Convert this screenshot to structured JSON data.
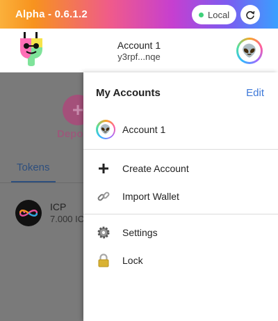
{
  "topbar": {
    "version": "Alpha - 0.6.1.2",
    "environment": "Local",
    "environment_status_color": "#3fd07a",
    "refresh_icon": "refresh-icon"
  },
  "header": {
    "account_name": "Account 1",
    "account_address": "y3rpf...nqe",
    "avatar_icon": "alien-icon"
  },
  "background": {
    "deposit_label": "Depo",
    "tab_tokens": "Tokens",
    "token": {
      "symbol": "ICP",
      "amount": "7.000 IC"
    }
  },
  "menu": {
    "title": "My Accounts",
    "edit_label": "Edit",
    "accounts": [
      {
        "label": "Account 1",
        "icon": "alien-icon"
      }
    ],
    "actions": [
      {
        "label": "Create Account",
        "icon": "plus-icon"
      },
      {
        "label": "Import Wallet",
        "icon": "link-icon"
      }
    ],
    "settings": [
      {
        "label": "Settings",
        "icon": "gear-icon"
      },
      {
        "label": "Lock",
        "icon": "lock-icon"
      }
    ]
  },
  "colors": {
    "accent_link": "#3d78d8",
    "tab_active": "#2e4f7e"
  }
}
